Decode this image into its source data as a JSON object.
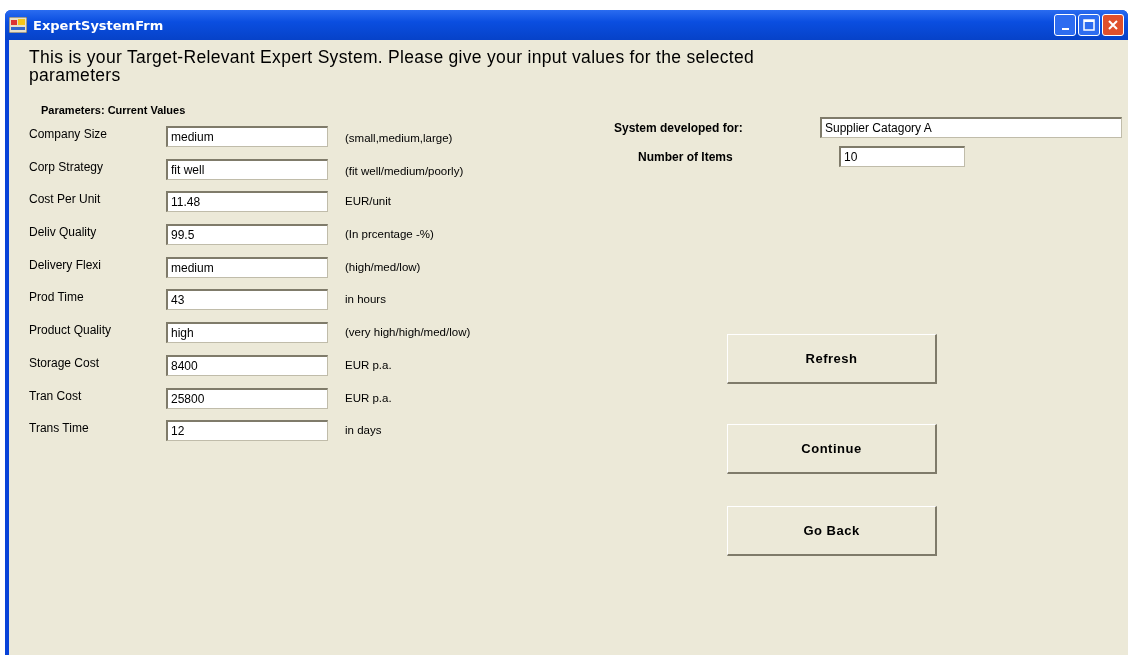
{
  "window": {
    "title": "ExpertSystemFrm"
  },
  "heading": "This is your Target-Relevant Expert System. Please give your input values for the selected parameters",
  "parameters": {
    "title": "Parameters: Current Values",
    "rows": [
      {
        "label": "Company Size",
        "value": "medium",
        "hint": "(small,medium,large)"
      },
      {
        "label": "Corp Strategy",
        "value": "fit well",
        "hint": "(fit well/medium/poorly)"
      },
      {
        "label": "Cost Per Unit",
        "value": "11.48",
        "hint": "EUR/unit"
      },
      {
        "label": "Deliv Quality",
        "value": "99.5",
        "hint": "(In prcentage -%)"
      },
      {
        "label": "Delivery Flexi",
        "value": "medium",
        "hint": "(high/med/low)"
      },
      {
        "label": "Prod Time",
        "value": "43",
        "hint": "in hours"
      },
      {
        "label": "Product Quality",
        "value": "high",
        "hint": "(very high/high/med/low)"
      },
      {
        "label": "Storage Cost",
        "value": "8400",
        "hint": "EUR p.a."
      },
      {
        "label": "Tran Cost",
        "value": "25800",
        "hint": "EUR p.a."
      },
      {
        "label": "Trans Time",
        "value": "12",
        "hint": "in days"
      }
    ]
  },
  "system_developed_for": {
    "label": "System developed for:",
    "value": "Supplier Catagory A"
  },
  "number_of_items": {
    "label": "Number of Items",
    "value": "10"
  },
  "buttons": [
    "Refresh",
    "Continue",
    "Go Back"
  ]
}
